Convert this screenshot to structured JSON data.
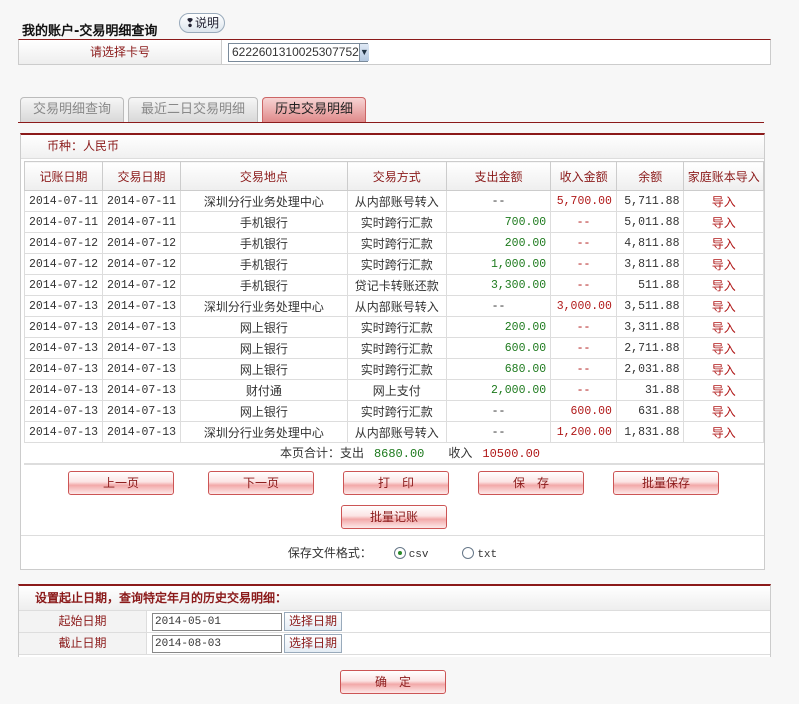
{
  "header": {
    "title": "我的账户-交易明细查询",
    "help_label": "说明"
  },
  "card": {
    "label": "请选择卡号",
    "selected": "6222601310025307752"
  },
  "tabs": [
    {
      "label": "交易明细查询"
    },
    {
      "label": "最近二日交易明细"
    },
    {
      "label": "历史交易明细",
      "active": true
    }
  ],
  "currency": "币种：人民币",
  "table": {
    "columns": [
      "记账日期",
      "交易日期",
      "交易地点",
      "交易方式",
      "支出金额",
      "收入金额",
      "余额",
      "家庭账本导入"
    ],
    "rows": [
      [
        "2014-07-11",
        "2014-07-11",
        "深圳分行业务处理中心",
        "从内部账号转入",
        "--",
        "5,700.00",
        "5,711.88",
        "导入"
      ],
      [
        "2014-07-11",
        "2014-07-11",
        "手机银行",
        "实时跨行汇款",
        "700.00",
        "--",
        "5,011.88",
        "导入"
      ],
      [
        "2014-07-12",
        "2014-07-12",
        "手机银行",
        "实时跨行汇款",
        "200.00",
        "--",
        "4,811.88",
        "导入"
      ],
      [
        "2014-07-12",
        "2014-07-12",
        "手机银行",
        "实时跨行汇款",
        "1,000.00",
        "--",
        "3,811.88",
        "导入"
      ],
      [
        "2014-07-12",
        "2014-07-12",
        "手机银行",
        "贷记卡转账还款",
        "3,300.00",
        "--",
        "511.88",
        "导入"
      ],
      [
        "2014-07-13",
        "2014-07-13",
        "深圳分行业务处理中心",
        "从内部账号转入",
        "--",
        "3,000.00",
        "3,511.88",
        "导入"
      ],
      [
        "2014-07-13",
        "2014-07-13",
        "网上银行",
        "实时跨行汇款",
        "200.00",
        "--",
        "3,311.88",
        "导入"
      ],
      [
        "2014-07-13",
        "2014-07-13",
        "网上银行",
        "实时跨行汇款",
        "600.00",
        "--",
        "2,711.88",
        "导入"
      ],
      [
        "2014-07-13",
        "2014-07-13",
        "网上银行",
        "实时跨行汇款",
        "680.00",
        "--",
        "2,031.88",
        "导入"
      ],
      [
        "2014-07-13",
        "2014-07-13",
        "财付通",
        "网上支付",
        "2,000.00",
        "--",
        "31.88",
        "导入"
      ],
      [
        "2014-07-13",
        "2014-07-13",
        "网上银行",
        "实时跨行汇款",
        "--",
        "600.00",
        "631.88",
        "导入"
      ],
      [
        "2014-07-13",
        "2014-07-13",
        "深圳分行业务处理中心",
        "从内部账号转入",
        "--",
        "1,200.00",
        "1,831.88",
        "导入"
      ]
    ]
  },
  "total": {
    "label": "本页合计：支出",
    "out": "8680.00",
    "in_label": "收入",
    "in": "10500.00"
  },
  "buttons": {
    "prev": "上一页",
    "next": "下一页",
    "print": "打　印",
    "save": "保　存",
    "batch_save": "批量保存",
    "batch_book": "批量记账",
    "confirm": "确　定"
  },
  "format": {
    "label": "保存文件格式：",
    "options": [
      "csv",
      "txt"
    ],
    "selected": "csv"
  },
  "dates": {
    "title": "设置起止日期，查询特定年月的历史交易明细：",
    "start_label": "起始日期",
    "start": "2014-05-01",
    "end_label": "截止日期",
    "end": "2014-08-03",
    "pick_label": "选择日期"
  }
}
